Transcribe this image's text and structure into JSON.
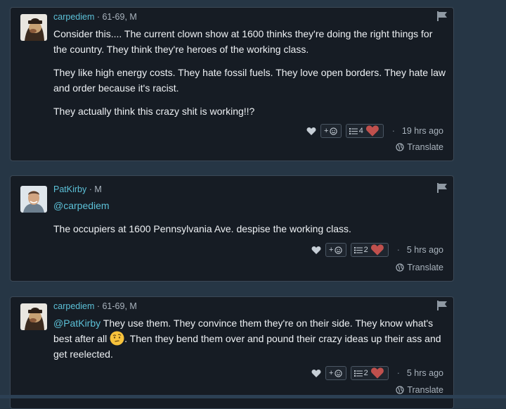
{
  "comments": [
    {
      "username": "carpediem",
      "meta": " · 61-69, M",
      "paragraphs": [
        "Consider this.... The current clown show at 1600 thinks they're doing the right things for the country. They think they're heroes of the working class.",
        "They like high energy costs. They hate fossil fuels. They love open borders. They hate law and order because it's racist.",
        "They actually think this crazy shit is working!!?"
      ],
      "react_label": "+",
      "reaction_count": "4",
      "time": "19 hrs ago",
      "translate": "Translate"
    },
    {
      "username": "PatKirby",
      "meta": " · M",
      "mention": "@carpediem",
      "text": "The occupiers at 1600 Pennsylvania Ave. despise the working class.",
      "react_label": "+",
      "reaction_count": "2",
      "time": "5 hrs ago",
      "translate": "Translate"
    },
    {
      "username": "carpediem",
      "meta": " · 61-69, M",
      "mention": "@PatKirby",
      "text_before_emoji": " They use them. They convince them they're on their side. They know what's best after all ",
      "text_after_emoji": ". Then they bend them over and pound their crazy ideas up their ass and get reelected.",
      "react_label": "+",
      "reaction_count": "2",
      "time": "5 hrs ago",
      "translate": "Translate"
    }
  ],
  "colors": {
    "background": "#263645",
    "card": "#161c24",
    "username": "#5cc1d8",
    "heart": "#c0504d"
  }
}
